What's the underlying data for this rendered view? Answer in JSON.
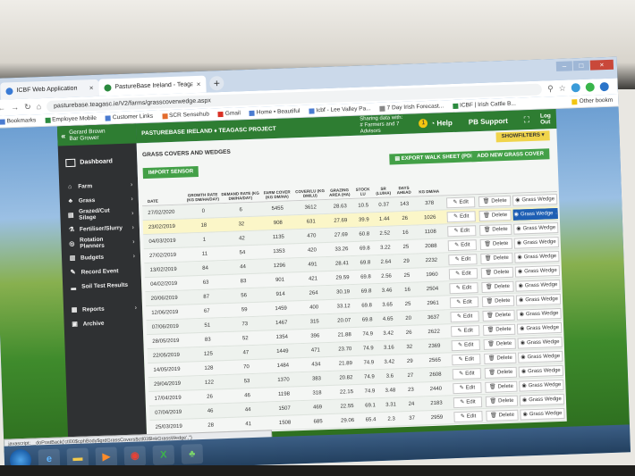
{
  "browser": {
    "tabs": [
      {
        "label": "ICBF Web Application"
      },
      {
        "label": "PastureBase Ireland - Teagasc"
      }
    ],
    "url": "pasturebase.teagasc.ie/V2/farms/grasscoverwedge.aspx",
    "bookmarks": [
      "Bookmarks",
      "Employee Mobile",
      "Customer Links",
      "SCR Sensehub",
      "Gmail",
      "Home • Beautiful",
      "Icbf - Lee Valley Pa...",
      "7 Day Irish Forecast...",
      "ICBF | Irish Cattle B..."
    ],
    "other_bookmarks": "Other bookm"
  },
  "user": {
    "name": "Gerard Brown",
    "role": "Bar Grower"
  },
  "topnav": {
    "brand": "PASTUREBASE IRELAND ♦ TEAGASC PROJECT",
    "share_line1": "Sharing data with:",
    "share_line2": "# Farmers and 7 Advisors",
    "share_count": "1",
    "help": "Help",
    "pb_support": "PB Support",
    "log": "Log",
    "out": "Out"
  },
  "sidebar": {
    "dashboard": "Dashboard",
    "items": [
      "Farm",
      "Grass",
      "Grazed/Cut Silage",
      "Fertiliser/Slurry",
      "Rotation Planners",
      "Budgets",
      "Record Event",
      "Soil Test Results"
    ],
    "items2": [
      "Reports",
      "Archive"
    ]
  },
  "page": {
    "title": "GRASS COVERS AND WEDGES",
    "show_filters": "SHOWFILTERS",
    "import_button": "IMPORT SENSOR",
    "export_button": "EXPORT WALK SHEET (PDF)",
    "add_button": "ADD NEW GRASS COVER"
  },
  "table": {
    "columns": [
      "DATE",
      "GROWTH RATE (KG DM/HA/DAY)",
      "DEMAND RATE (KG DM/HA/DAY)",
      "FARM COVER (KG DM/HA)",
      "COVER/LU (KG DM/LU)",
      "GRAZING AREA (HA)",
      "STOCK LU",
      "SR (LU/HA)",
      "DAYS AHEAD",
      "KG DM/HA"
    ],
    "edit_label": "Edit",
    "delete_label": "Delete",
    "wedge_label": "Grass Wedge",
    "rows": [
      [
        "27/02/2020",
        "0",
        "6",
        "5455",
        "3612",
        "28.63",
        "10.5",
        "0.37",
        "143",
        "378"
      ],
      [
        "23/02/2019",
        "18",
        "32",
        "908",
        "631",
        "27.69",
        "39.9",
        "1.44",
        "26",
        "1026"
      ],
      [
        "04/03/2019",
        "1",
        "42",
        "1135",
        "470",
        "27.69",
        "60.8",
        "2.52",
        "16",
        "1108"
      ],
      [
        "27/02/2019",
        "11",
        "54",
        "1353",
        "420",
        "33.26",
        "69.8",
        "3.22",
        "25",
        "2088"
      ],
      [
        "13/02/2019",
        "84",
        "44",
        "1296",
        "491",
        "28.41",
        "69.8",
        "2.64",
        "29",
        "2232"
      ],
      [
        "04/02/2019",
        "63",
        "83",
        "901",
        "421",
        "29.59",
        "69.8",
        "2.56",
        "25",
        "1960"
      ],
      [
        "20/06/2019",
        "87",
        "56",
        "914",
        "264",
        "30.19",
        "69.8",
        "3.46",
        "16",
        "2504"
      ],
      [
        "12/06/2019",
        "67",
        "59",
        "1459",
        "400",
        "33.12",
        "69.8",
        "3.65",
        "25",
        "2961"
      ],
      [
        "07/06/2019",
        "51",
        "73",
        "1467",
        "315",
        "20.07",
        "69.8",
        "4.65",
        "20",
        "3637"
      ],
      [
        "28/05/2019",
        "83",
        "52",
        "1354",
        "396",
        "21.88",
        "74.9",
        "3.42",
        "26",
        "2622"
      ],
      [
        "22/05/2019",
        "125",
        "47",
        "1449",
        "471",
        "23.70",
        "74.9",
        "3.16",
        "32",
        "2369"
      ],
      [
        "14/05/2019",
        "128",
        "70",
        "1484",
        "434",
        "21.89",
        "74.9",
        "3.42",
        "29",
        "2565"
      ],
      [
        "29/04/2019",
        "122",
        "53",
        "1370",
        "383",
        "20.82",
        "74.9",
        "3.6",
        "27",
        "2608"
      ],
      [
        "17/04/2019",
        "26",
        "46",
        "1198",
        "318",
        "22.15",
        "74.9",
        "3.48",
        "23",
        "2440"
      ],
      [
        "07/04/2019",
        "46",
        "44",
        "1507",
        "469",
        "22.55",
        "69.1",
        "3.31",
        "24",
        "2183"
      ],
      [
        "25/03/2019",
        "28",
        "41",
        "1508",
        "685",
        "29.06",
        "65.4",
        "2.3",
        "37",
        "2959"
      ]
    ],
    "active_wedge_row": 1
  },
  "status_url": "javascript:__doPostBack('ctl00$cphBody$grdGrassCovers$ctl03$lnkGrassWedge','')"
}
